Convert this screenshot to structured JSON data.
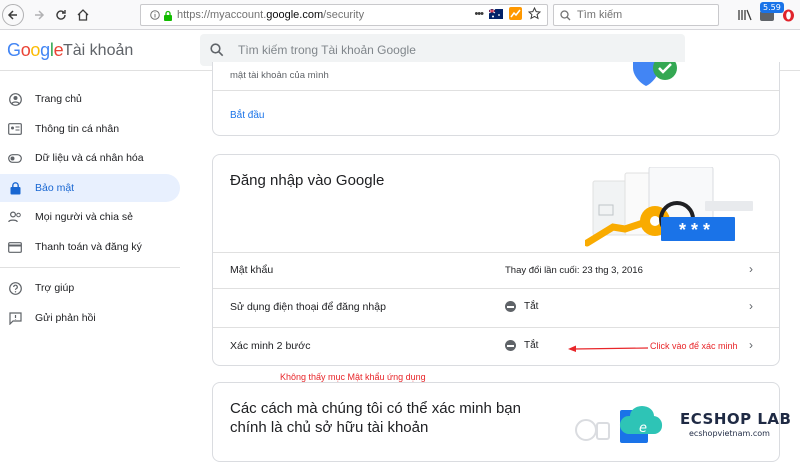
{
  "browser": {
    "url_prefix": "https://myaccount.",
    "url_domain": "google.com",
    "url_suffix": "/security",
    "search_placeholder": "Tìm kiếm",
    "extension_badge": "5.59"
  },
  "header": {
    "logo": "Google",
    "suffix": "Tài khoản",
    "search_placeholder": "Tìm kiếm trong Tài khoản Google"
  },
  "sidebar": {
    "items": [
      {
        "label": "Trang chủ",
        "icon": "account-circle-icon"
      },
      {
        "label": "Thông tin cá nhân",
        "icon": "id-card-icon"
      },
      {
        "label": "Dữ liệu và cá nhân hóa",
        "icon": "toggle-icon"
      },
      {
        "label": "Bảo mật",
        "icon": "lock-icon"
      },
      {
        "label": "Mọi người và chia sẻ",
        "icon": "people-icon"
      },
      {
        "label": "Thanh toán và đăng ký",
        "icon": "credit-card-icon"
      },
      {
        "label": "Trợ giúp",
        "icon": "help-icon"
      },
      {
        "label": "Gửi phản hồi",
        "icon": "feedback-icon"
      }
    ]
  },
  "card_top": {
    "partial_text": "mật tài khoản của mình",
    "link": "Bắt đầu"
  },
  "signin_card": {
    "title": "Đăng nhập vào Google",
    "rows": [
      {
        "label": "Mật khẩu",
        "value": "Thay đổi lần cuối: 23 thg 3, 2016"
      },
      {
        "label": "Sử dụng điện thoại để đăng nhập",
        "value": "Tắt"
      },
      {
        "label": "Xác minh 2 bước",
        "value": "Tắt"
      }
    ],
    "password_dots": "* * *"
  },
  "annotations": {
    "click_note": "Click vào để xác minh",
    "missing_note": "Không thấy mục Mật khẩu ứng dụng"
  },
  "verify_card": {
    "title_line1": "Các cách mà chúng tôi có thể xác minh bạn",
    "title_line2": "chính là chủ sở hữu tài khoản"
  },
  "watermark": {
    "name": "ECSHOP LAB",
    "site": "ecshopvietnam.com",
    "letter": "e"
  },
  "colors": {
    "accent_blue": "#1a73e8",
    "active_bg": "#e8f0fe",
    "annotation_red": "#e8262a"
  }
}
